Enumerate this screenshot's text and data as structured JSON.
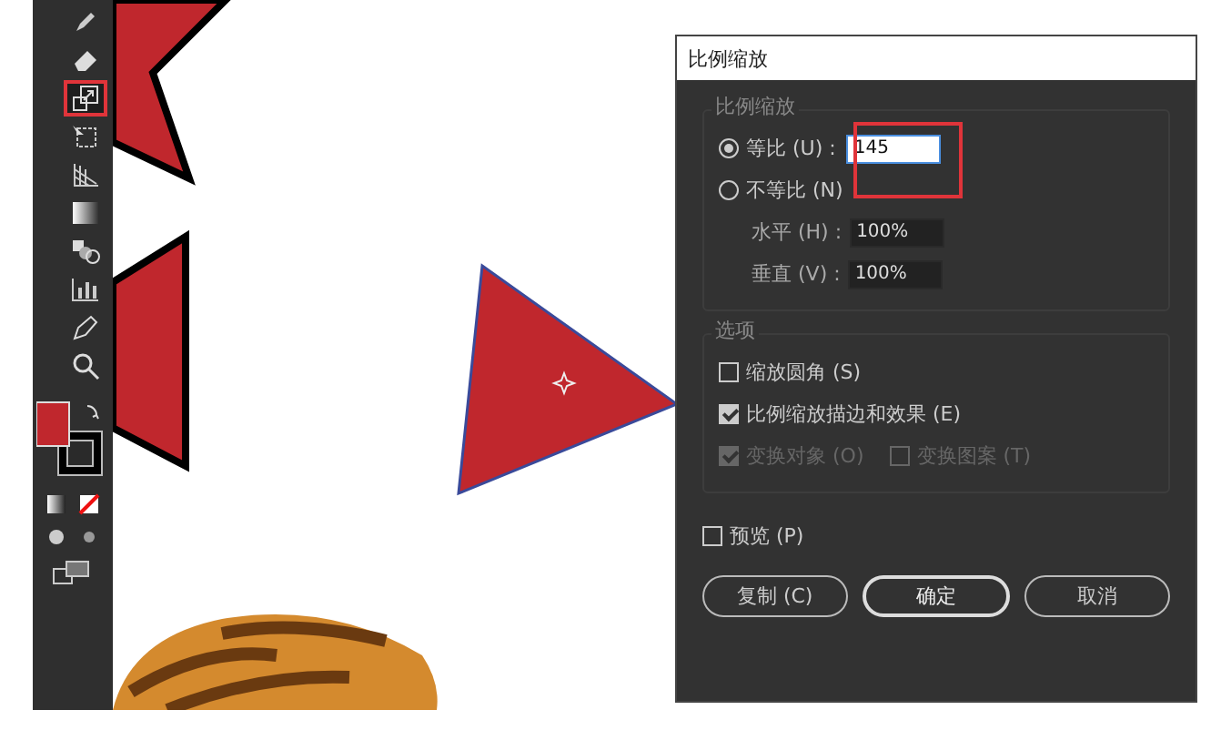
{
  "toolbar": {
    "tools": [
      {
        "kind": "pencil",
        "selected": false
      },
      {
        "kind": "eraser",
        "selected": false
      },
      {
        "kind": "scale",
        "selected": true
      },
      {
        "kind": "free-transform",
        "selected": false
      },
      {
        "kind": "perspective-grid",
        "selected": false
      },
      {
        "kind": "gradient",
        "selected": false
      },
      {
        "kind": "blend",
        "selected": false
      },
      {
        "kind": "column-graph",
        "selected": false
      },
      {
        "kind": "pen",
        "selected": false
      },
      {
        "kind": "zoom",
        "selected": false
      }
    ]
  },
  "dialog": {
    "title": "比例缩放",
    "scale_group": {
      "legend": "比例缩放",
      "options": [
        {
          "label": "等比 (U) :",
          "value": "145",
          "selected": true,
          "highlighted": true
        },
        {
          "label": "不等比 (N)",
          "selected": false
        }
      ],
      "fields": [
        {
          "label": "水平 (H) :",
          "value": "100%"
        },
        {
          "label": "垂直 (V) :",
          "value": "100%"
        }
      ]
    },
    "options_group": {
      "legend": "选项",
      "checkboxes": [
        {
          "label": "缩放圆角 (S)",
          "checked": false,
          "disabled": false
        },
        {
          "label": "比例缩放描边和效果 (E)",
          "checked": true,
          "disabled": false
        }
      ],
      "transform_checkboxes": [
        {
          "label": "变换对象 (O)",
          "checked": true,
          "disabled": true
        },
        {
          "label": "变换图案 (T)",
          "checked": false,
          "disabled": true
        }
      ]
    },
    "preview": {
      "label": "预览 (P)",
      "checked": false
    },
    "buttons": [
      {
        "label": "复制 (C)",
        "default": false
      },
      {
        "label": "确定",
        "default": true
      },
      {
        "label": "取消",
        "default": false
      }
    ]
  }
}
